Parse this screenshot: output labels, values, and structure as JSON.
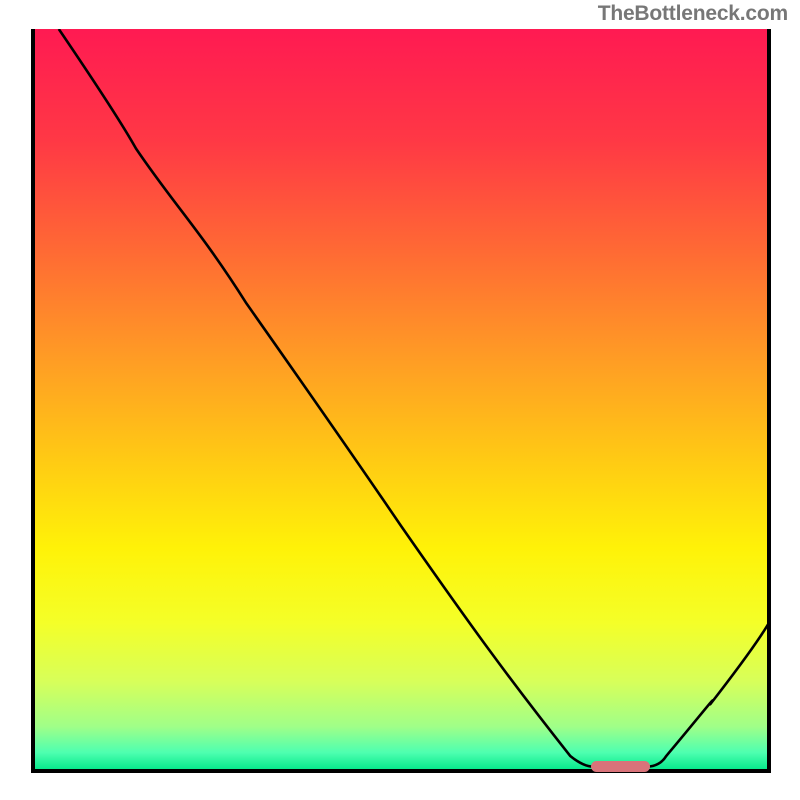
{
  "attribution": "TheBottleneck.com",
  "chart_data": {
    "type": "line",
    "title": "",
    "xlabel": "",
    "ylabel": "",
    "xlim": [
      0,
      100
    ],
    "ylim": [
      0,
      100
    ],
    "grid": false,
    "legend": null,
    "background_gradient": {
      "stops": [
        {
          "offset": 0.0,
          "color": "#ff1a52"
        },
        {
          "offset": 0.15,
          "color": "#ff3845"
        },
        {
          "offset": 0.3,
          "color": "#ff6a34"
        },
        {
          "offset": 0.45,
          "color": "#ff9e24"
        },
        {
          "offset": 0.58,
          "color": "#ffca14"
        },
        {
          "offset": 0.7,
          "color": "#fff208"
        },
        {
          "offset": 0.8,
          "color": "#f4ff28"
        },
        {
          "offset": 0.88,
          "color": "#d7ff5a"
        },
        {
          "offset": 0.94,
          "color": "#a0ff88"
        },
        {
          "offset": 0.975,
          "color": "#4effb0"
        },
        {
          "offset": 1.0,
          "color": "#00e788"
        }
      ]
    },
    "series": [
      {
        "name": "bottleneck-curve",
        "type": "line",
        "color": "#000000",
        "points": [
          {
            "x": 3.5,
            "y": 100.0
          },
          {
            "x": 14.0,
            "y": 84.0
          },
          {
            "x": 22.0,
            "y": 73.0
          },
          {
            "x": 29.0,
            "y": 63.0
          },
          {
            "x": 50.0,
            "y": 33.0
          },
          {
            "x": 65.0,
            "y": 12.0
          },
          {
            "x": 73.0,
            "y": 2.0
          },
          {
            "x": 76.0,
            "y": 0.6
          },
          {
            "x": 83.5,
            "y": 0.6
          },
          {
            "x": 86.0,
            "y": 2.0
          },
          {
            "x": 92.0,
            "y": 9.0
          },
          {
            "x": 100.0,
            "y": 20.0
          }
        ]
      }
    ],
    "markers": [
      {
        "name": "optimal-range-marker",
        "shape": "capsule",
        "color": "#d9737a",
        "x_start": 76.0,
        "x_end": 83.5,
        "y": 0.6
      }
    ]
  }
}
